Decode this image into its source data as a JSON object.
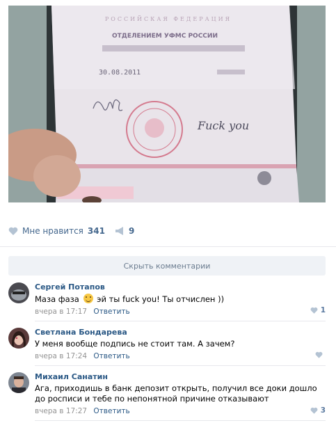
{
  "post": {
    "photo": {
      "alt": "",
      "header_text": "РОССИЙСКАЯ ФЕДЕРАЦИЯ",
      "issuer_text": "ОТДЕЛЕНИЕМ УФМС РОССИИ",
      "date_text": "30.08.2011",
      "signature_text": "Fuck you"
    },
    "likes": {
      "label": "Мне нравится",
      "count": "341"
    },
    "shares": {
      "count": "9"
    }
  },
  "comments_toggle": {
    "label": "Скрыть комментарии"
  },
  "comments": [
    {
      "author": "Сергей Потапов",
      "text_before_emoji": "Маза фаза",
      "text_after_emoji": "эй ты fuck you! Ты отчислен ))",
      "time": "вчера в 17:17",
      "reply_label": "Ответить",
      "likes": "1"
    },
    {
      "author": "Светлана Бондарева",
      "text": "У меня вообще подпись не стоит там. А зачем?",
      "time": "вчера в 17:24",
      "reply_label": "Ответить",
      "likes": ""
    },
    {
      "author": "Михаил Санатин",
      "text": "Ага, приходишь в банк депозит открыть, получил все доки дошло до росписи и тебе по непонятной причине отказывают",
      "time": "вчера в 17:27",
      "reply_label": "Ответить",
      "likes": "3"
    }
  ],
  "colors": {
    "link": "#2a5885",
    "meta": "#939393",
    "like_icon": "#b4c3d3",
    "bar_bg": "#eff2f6"
  }
}
